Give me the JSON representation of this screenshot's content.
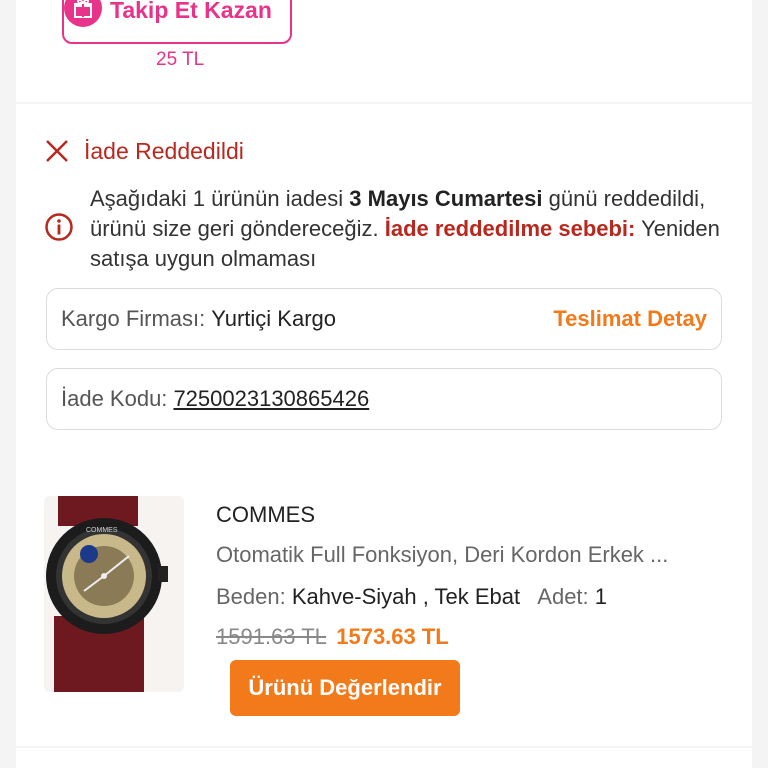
{
  "follow": {
    "label": "Takip Et Kazan",
    "amount": "25 TL",
    "icon": "gift-icon",
    "color": "#e8338a"
  },
  "status": {
    "title": "İade Reddedildi",
    "icon": "close-icon",
    "color": "#b8281e"
  },
  "description": {
    "part1": "Aşağıdaki 1 ürünün iadesi ",
    "date": "3 Mayıs Cumartesi",
    "part2": " günü reddedildi, ürünü size geri göndereceğiz. ",
    "reason_label": "İade reddedilme sebebi:",
    "reason": " Yeniden satışa uygun olmaması",
    "icon": "info-icon"
  },
  "cargo": {
    "label": "Kargo Firması:",
    "company": "Yurtiçi Kargo",
    "detail_link": "Teslimat Detay"
  },
  "return_code": {
    "label": "İade Kodu:",
    "code": "7250023130865426"
  },
  "product": {
    "brand": "COMMES",
    "name": "Otomatik Full Fonksiyon, Deri Kordon Erkek ...",
    "size_label": "Beden:",
    "size_value": "Kahve-Siyah , Tek Ebat",
    "qty_label": "Adet:",
    "qty_value": "1",
    "old_price": "1591.63 TL",
    "new_price": "1573.63 TL",
    "watch_brand_text": "COMMES"
  },
  "review_button": "Ürünü Değerlendir",
  "colors": {
    "accent_orange": "#f27a1a",
    "pink": "#e8338a",
    "error_red": "#b8281e"
  }
}
